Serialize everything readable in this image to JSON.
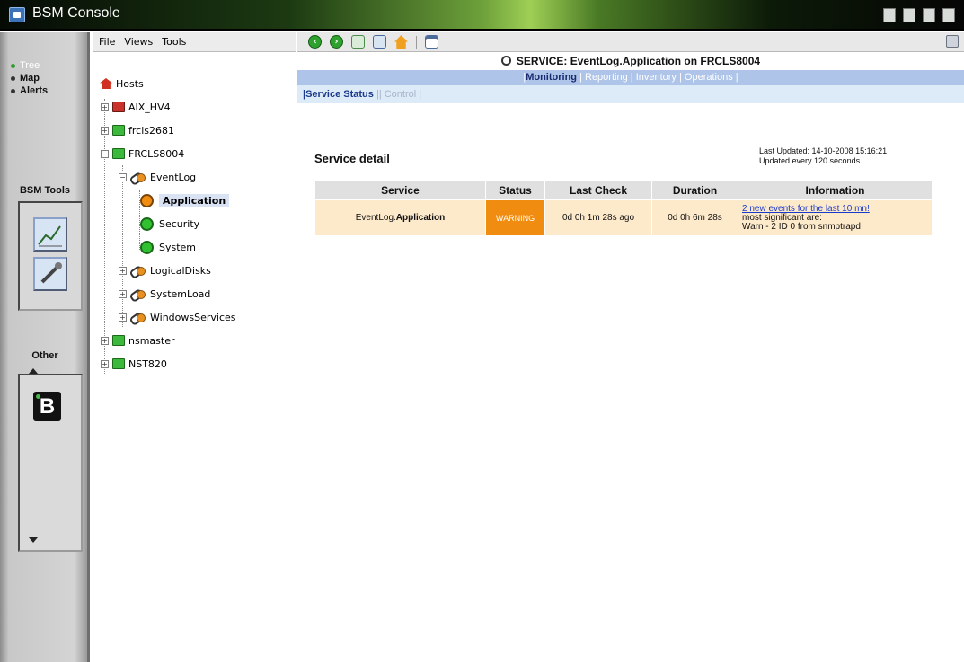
{
  "window": {
    "title": "BSM Console"
  },
  "nav": {
    "items": [
      {
        "label": "Tree",
        "active": true
      },
      {
        "label": "Map",
        "active": false
      },
      {
        "label": "Alerts",
        "active": false
      }
    ],
    "tools_title": "BSM Tools",
    "other_title": "Other",
    "tool_icons": [
      "chart-icon",
      "tools-icon"
    ],
    "other_icons": [
      "bsm-b-icon"
    ]
  },
  "menu": {
    "file": "File",
    "views": "Views",
    "tools": "Tools"
  },
  "tree": {
    "root": "Hosts",
    "hosts": [
      {
        "label": "AIX_HV4",
        "status": "red"
      },
      {
        "label": "frcls2681",
        "status": "green"
      },
      {
        "label": "FRCLS8004",
        "status": "green"
      }
    ],
    "groups": {
      "eventlog": "EventLog",
      "logicaldisks": "LogicalDisks",
      "systemload": "SystemLoad",
      "windowsservices": "WindowsServices"
    },
    "services": [
      {
        "label": "Application",
        "status": "orange"
      },
      {
        "label": "Security",
        "status": "green"
      },
      {
        "label": "System",
        "status": "green"
      }
    ],
    "more_hosts": [
      {
        "label": "nsmaster",
        "status": "green"
      },
      {
        "label": "NST820",
        "status": "green"
      }
    ]
  },
  "toolbar": {
    "icons": [
      "back-icon",
      "forward-icon",
      "document-icon",
      "refresh-icon",
      "home-icon",
      "window-icon",
      "user-icon"
    ]
  },
  "service": {
    "header": "SERVICE: EventLog.Application on FRCLS8004",
    "tabs": [
      "Monitoring",
      "Reporting",
      "Inventory",
      "Operations"
    ],
    "subtabs": [
      "Service Status",
      "Control"
    ],
    "detail_title": "Service detail",
    "last_updated": "Last Updated: 14-10-2008 15:16:21",
    "update_interval": "Updated every 120 seconds",
    "table": {
      "headers": [
        "Service",
        "Status",
        "Last Check",
        "Duration",
        "Information"
      ],
      "row": {
        "service_prefix": "EventLog.",
        "service_name": "Application",
        "status": "WARNING",
        "last_check": "0d 0h 1m 28s ago",
        "duration": "0d 0h 6m 28s",
        "info_link": "2 new events for the last 10 mn!",
        "info_line2": "most significant are:",
        "info_line3": "Warn - 2 ID 0 from snmptrapd"
      }
    },
    "colors": {
      "warning": "#f08c10",
      "row_bg": "#fdeacb",
      "tab_bar": "#aec4e8",
      "subtab_bar": "#ddeaf8"
    }
  }
}
